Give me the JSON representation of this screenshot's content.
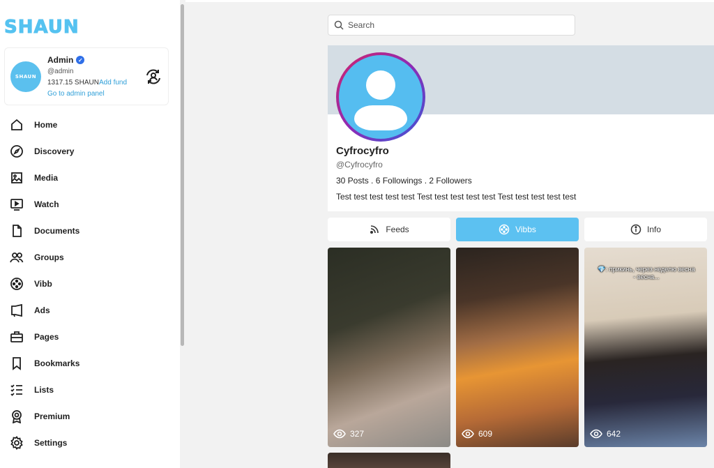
{
  "sidebar": {
    "logo": "SHAUN",
    "user": {
      "avatar_text": "SHAUN",
      "name": "Admin",
      "handle": "@admin",
      "balance": "1317.15 SHAUN",
      "add_fund": "Add fund",
      "admin_panel": "Go to admin panel"
    },
    "items": [
      {
        "label": "Home",
        "icon": "home-icon"
      },
      {
        "label": "Discovery",
        "icon": "compass-icon"
      },
      {
        "label": "Media",
        "icon": "image-icon"
      },
      {
        "label": "Watch",
        "icon": "play-icon"
      },
      {
        "label": "Documents",
        "icon": "document-icon"
      },
      {
        "label": "Groups",
        "icon": "groups-icon"
      },
      {
        "label": "Vibb",
        "icon": "film-reel-icon"
      },
      {
        "label": "Ads",
        "icon": "megaphone-icon"
      },
      {
        "label": "Pages",
        "icon": "briefcase-icon"
      },
      {
        "label": "Bookmarks",
        "icon": "bookmark-icon"
      },
      {
        "label": "Lists",
        "icon": "checklist-icon"
      },
      {
        "label": "Premium",
        "icon": "award-icon"
      },
      {
        "label": "Settings",
        "icon": "gear-icon"
      }
    ]
  },
  "search": {
    "placeholder": "Search"
  },
  "profile": {
    "name": "Cyfrocyfro",
    "handle": "@Cyfrocyfro",
    "stats": "30 Posts . 6 Followings . 2 Followers",
    "bio": "Test test test test test Test test test test test Test test test test test"
  },
  "tabs": [
    {
      "label": "Feeds",
      "icon": "rss-icon",
      "active": false
    },
    {
      "label": "Vibbs",
      "icon": "film-reel-icon",
      "active": true
    },
    {
      "label": "Info",
      "icon": "info-icon",
      "active": false
    }
  ],
  "vibbs": [
    {
      "views": "327"
    },
    {
      "views": "609"
    },
    {
      "views": "642",
      "caption": "💎: прикинь, через неделю весна\n- весна..."
    }
  ],
  "colors": {
    "accent": "#5cc1f1",
    "link": "#2f9fd8",
    "verified": "#2f6fe8"
  }
}
